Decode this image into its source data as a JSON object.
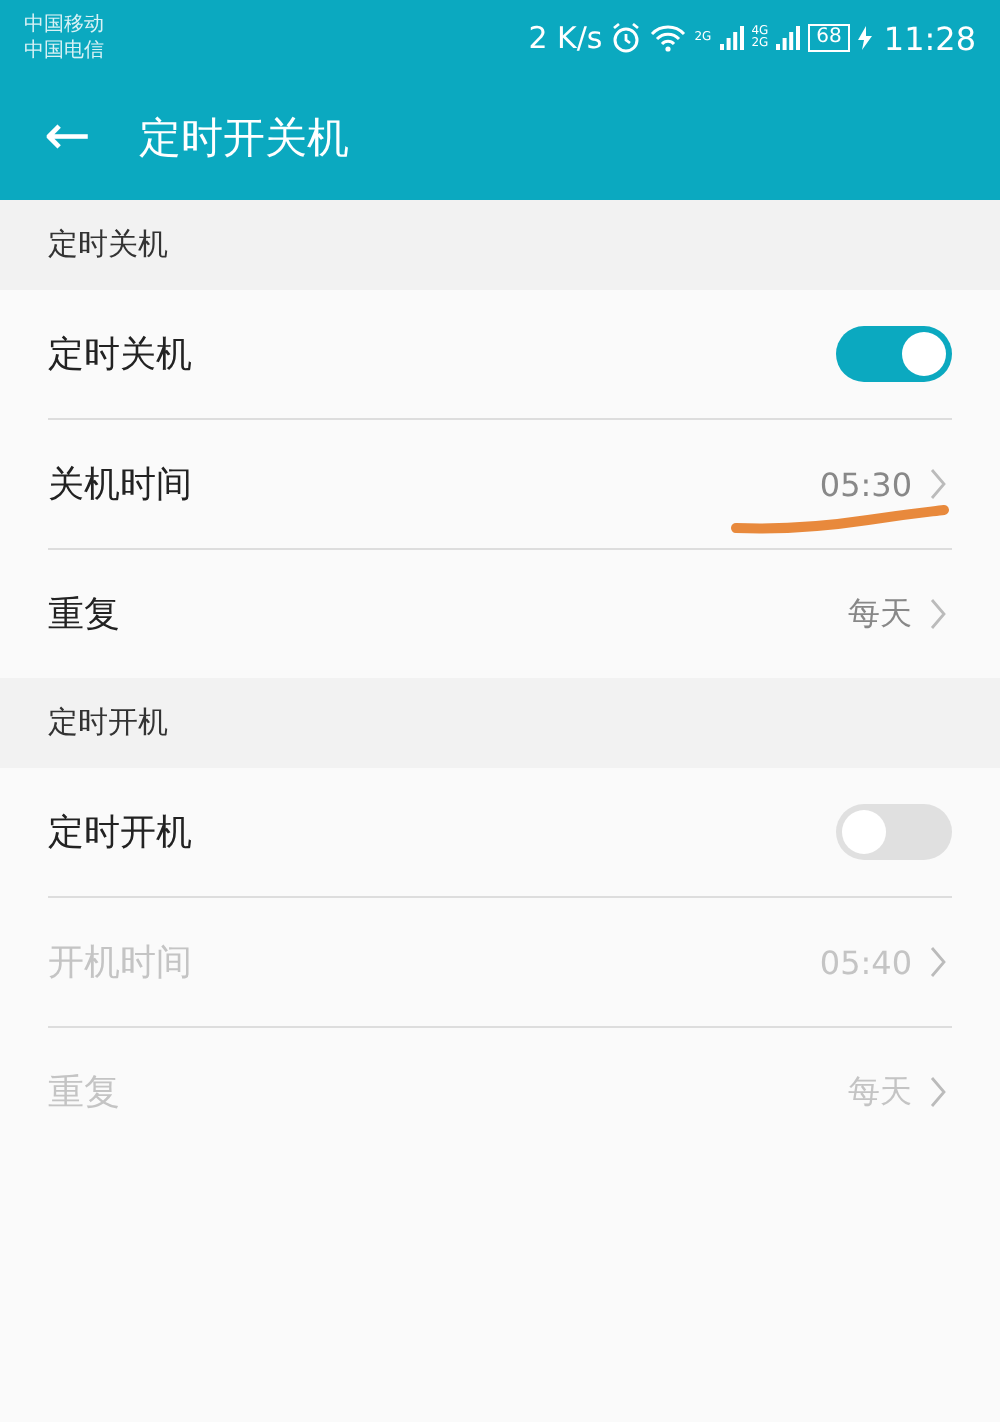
{
  "status_bar": {
    "carriers": [
      "中国移动",
      "中国电信"
    ],
    "speed": "2 K/s",
    "sim1_network": "2G",
    "sim2_networks": [
      "4G",
      "2G"
    ],
    "battery": "68",
    "time": "11:28"
  },
  "title_bar": {
    "back_icon": "←",
    "title": "定时开关机"
  },
  "sections": [
    {
      "header": "定时关机",
      "rows": [
        {
          "kind": "toggle",
          "label": "定时关机",
          "on": true,
          "disabled": false
        },
        {
          "kind": "value",
          "label": "关机时间",
          "value": "05:30",
          "disabled": false,
          "underlined": true
        },
        {
          "kind": "value",
          "label": "重复",
          "value": "每天",
          "disabled": false,
          "underlined": false
        }
      ]
    },
    {
      "header": "定时开机",
      "rows": [
        {
          "kind": "toggle",
          "label": "定时开机",
          "on": false,
          "disabled": false
        },
        {
          "kind": "value",
          "label": "开机时间",
          "value": "05:40",
          "disabled": true,
          "underlined": false
        },
        {
          "kind": "value",
          "label": "重复",
          "value": "每天",
          "disabled": true,
          "underlined": false
        }
      ]
    }
  ]
}
